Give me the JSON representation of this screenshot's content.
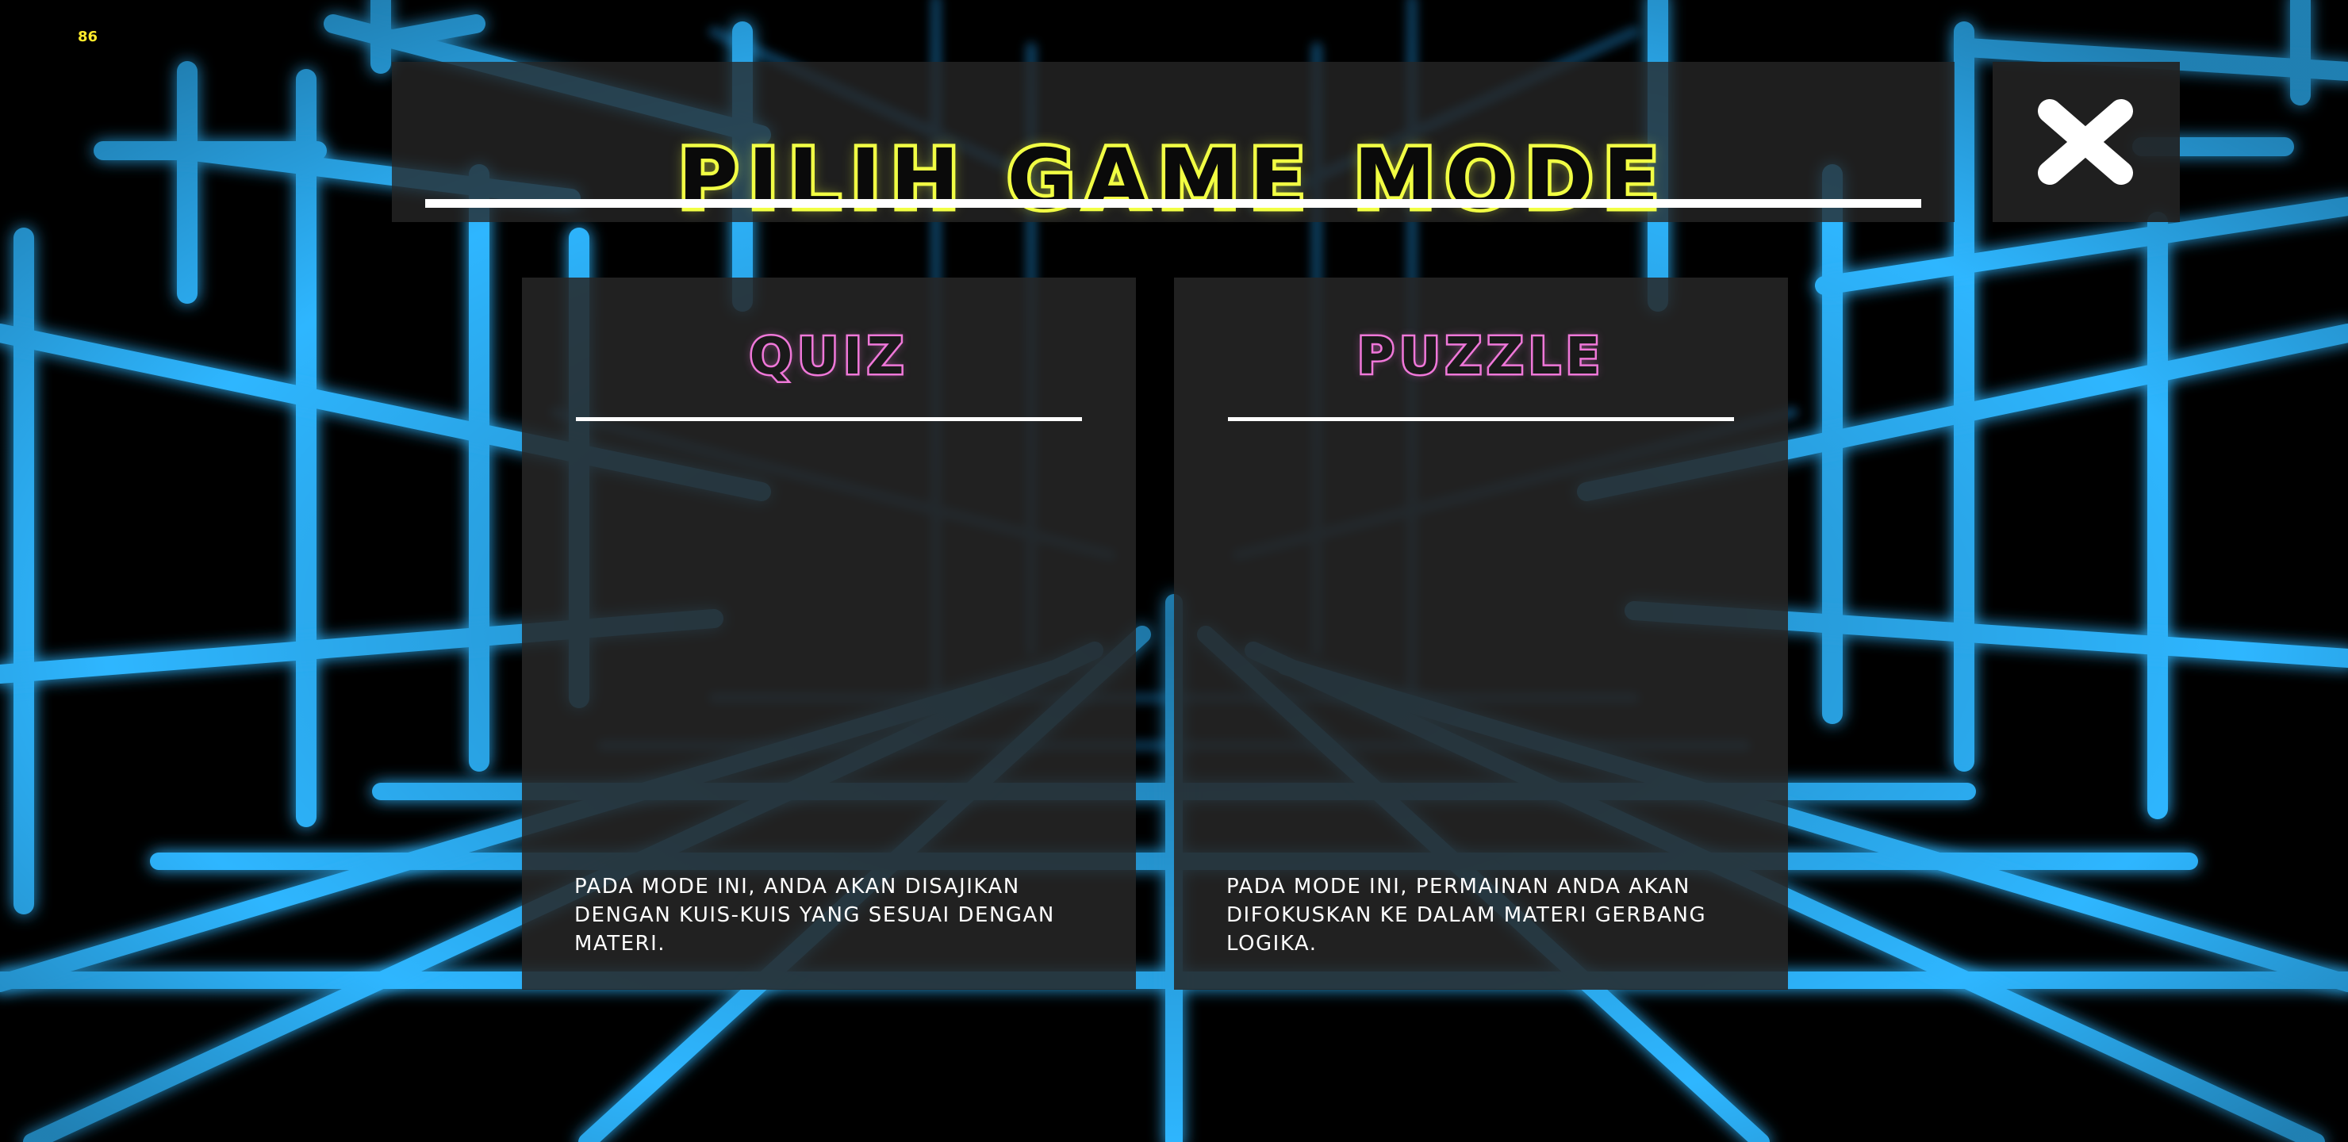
{
  "fps_counter": "86",
  "header": {
    "title": "PILIH GAME MODE",
    "close_icon": "close-x-icon"
  },
  "modes": [
    {
      "title": "QUIZ",
      "description": "PADA MODE INI, ANDA AKAN DISAJIKAN DENGAN KUIS-KUIS YANG SESUAI DENGAN MATERI."
    },
    {
      "title": "PUZZLE",
      "description": "PADA MODE INI, PERMAINAN ANDA AKAN DIFOKUSKAN KE DALAM MATERI GERBANG LOGIKA."
    }
  ],
  "colors": {
    "title_outline": "#f2ff47",
    "card_title_outline": "#f07ad9",
    "grid_neon": "#2fb6ff",
    "fps_text": "#ffea2b",
    "panel_bg": "#262626"
  }
}
